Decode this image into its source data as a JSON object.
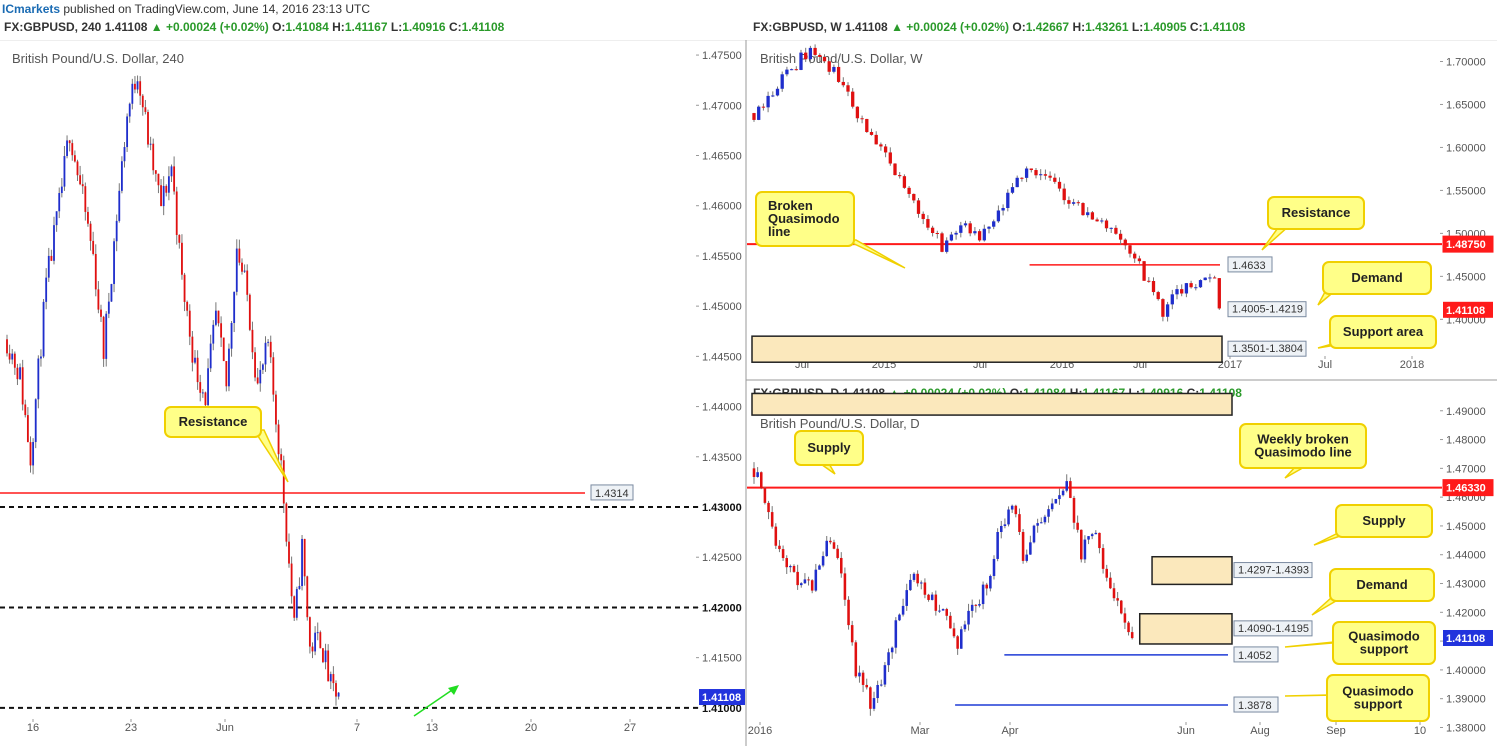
{
  "header": {
    "brand": "ICmarkets",
    "published": " published on TradingView.com, June 14, 2016 23:13 UTC"
  },
  "colors": {
    "up": "#1f2ecc",
    "down": "#e01010",
    "resistance": "#ff1a1a",
    "callout_fill": "#ffff88",
    "callout_border": "#f0d000",
    "zone_fill": "#fbe8bc",
    "blue_line": "#1f3bd6",
    "price_tag": "#2233dd"
  },
  "chart_data": [
    {
      "id": "h4",
      "type": "candlestick",
      "symbol_line": {
        "symbol": "FX:GBPUSD, 240",
        "last": "1.41108",
        "change": "+0.00024 (+0.02%)",
        "o_label": "O:",
        "o": "1.41084",
        "h_label": "H:",
        "h": "1.41167",
        "l_label": "L:",
        "l": "1.40916",
        "c_label": "C:",
        "c": "1.41108"
      },
      "title": "British Pound/U.S. Dollar, 240",
      "y_ticks": [
        "1.47500",
        "1.47000",
        "1.46500",
        "1.46000",
        "1.45500",
        "1.45000",
        "1.44500",
        "1.44000",
        "1.43500",
        "1.43000",
        "1.42500",
        "1.42000",
        "1.41500",
        "1.41000"
      ],
      "ylim": [
        1.407,
        1.4765
      ],
      "x_ticks": [
        "16",
        "23",
        "Jun",
        "7",
        "13",
        "20",
        "27"
      ],
      "x_tick_index": [
        4,
        33,
        63,
        85,
        107,
        135,
        163
      ],
      "n_bars": 180,
      "path": [
        [
          0,
          1.4467
        ],
        [
          5,
          1.443
        ],
        [
          9,
          1.435
        ],
        [
          15,
          1.452
        ],
        [
          20,
          1.46
        ],
        [
          24,
          1.4675
        ],
        [
          28,
          1.462
        ],
        [
          33,
          1.455
        ],
        [
          37,
          1.4455
        ],
        [
          42,
          1.459
        ],
        [
          46,
          1.469
        ],
        [
          50,
          1.4735
        ],
        [
          55,
          1.465
        ],
        [
          59,
          1.46
        ],
        [
          63,
          1.464
        ],
        [
          67,
          1.4525
        ],
        [
          72,
          1.444
        ],
        [
          76,
          1.441
        ],
        [
          80,
          1.449
        ],
        [
          84,
          1.442
        ],
        [
          88,
          1.456
        ],
        [
          92,
          1.451
        ],
        [
          96,
          1.442
        ],
        [
          100,
          1.446
        ],
        [
          105,
          1.434
        ],
        [
          110,
          1.418
        ],
        [
          113,
          1.426
        ],
        [
          116,
          1.416
        ],
        [
          120,
          1.417
        ],
        [
          124,
          1.412
        ],
        [
          127,
          1.41108
        ]
      ],
      "h_lines": [
        {
          "kind": "resistance",
          "value": 1.4314,
          "label": "1.4314"
        },
        {
          "kind": "dashed",
          "value": 1.43,
          "label": "1.43000"
        },
        {
          "kind": "dashed",
          "value": 1.42,
          "label": "1.42000"
        },
        {
          "kind": "dashed",
          "value": 1.41,
          "label": "1.41000"
        }
      ],
      "last_tag": "1.41108",
      "annotations": [
        {
          "text": "Resistance"
        }
      ]
    },
    {
      "id": "w",
      "type": "candlestick",
      "symbol_line": {
        "symbol": "FX:GBPUSD, W",
        "last": "1.41108",
        "change": "+0.00024 (+0.02%)",
        "o_label": "O:",
        "o": "1.42667",
        "h_label": "H:",
        "h": "1.43261",
        "l_label": "L:",
        "l": "1.40905",
        "c_label": "C:",
        "c": "1.41108"
      },
      "title": "British Pound/U.S. Dollar, W",
      "y_ticks": [
        "1.70000",
        "1.65000",
        "1.60000",
        "1.55000",
        "1.50000",
        "1.45000",
        "1.40000"
      ],
      "ylim": [
        1.355,
        1.725
      ],
      "x_ticks": [
        "Jul",
        "2015",
        "Jul",
        "2016",
        "Jul",
        "2017",
        "Jul",
        "2018"
      ],
      "x_tick_index": [
        10,
        36,
        62,
        88,
        114,
        140,
        166,
        192
      ],
      "n_bars": 100,
      "path": [
        [
          0,
          1.64
        ],
        [
          6,
          1.68
        ],
        [
          12,
          1.715
        ],
        [
          18,
          1.68
        ],
        [
          24,
          1.62
        ],
        [
          30,
          1.57
        ],
        [
          36,
          1.52
        ],
        [
          40,
          1.485
        ],
        [
          44,
          1.51
        ],
        [
          48,
          1.49
        ],
        [
          52,
          1.52
        ],
        [
          56,
          1.56
        ],
        [
          59,
          1.58
        ],
        [
          63,
          1.56
        ],
        [
          67,
          1.54
        ],
        [
          71,
          1.52
        ],
        [
          75,
          1.51
        ],
        [
          79,
          1.49
        ],
        [
          83,
          1.45
        ],
        [
          87,
          1.41
        ],
        [
          91,
          1.435
        ],
        [
          95,
          1.44
        ],
        [
          98,
          1.45
        ],
        [
          99,
          1.41108
        ]
      ],
      "zones": [
        {
          "label": "1.4005-1.4219",
          "low": 1.4005,
          "high": 1.4219,
          "from": 89
        },
        {
          "label": "1.3501-1.3804",
          "low": 1.3501,
          "high": 1.3804,
          "from": 0
        }
      ],
      "h_lines": [
        {
          "kind": "resistance",
          "value": 1.4875,
          "label": "1.48750"
        },
        {
          "kind": "resistance_thin",
          "value": 1.4633,
          "label": "1.4633",
          "from": 41
        }
      ],
      "last_tag": "1.41108",
      "annotations": [
        {
          "text": "Broken Quasimodo line"
        },
        {
          "text": "Resistance"
        },
        {
          "text": "Demand"
        },
        {
          "text": "Support area"
        }
      ]
    },
    {
      "id": "d",
      "type": "candlestick",
      "symbol_line": {
        "symbol": "FX:GBPUSD, D",
        "last": "1.41108",
        "change": "+0.00024 (+0.02%)",
        "o_label": "O:",
        "o": "1.41084",
        "h_label": "H:",
        "h": "1.41167",
        "l_label": "L:",
        "l": "1.40916",
        "c_label": "C:",
        "c": "1.41108"
      },
      "title": "British Pound/U.S. Dollar, D",
      "y_ticks": [
        "1.49000",
        "1.48000",
        "1.47000",
        "1.46000",
        "1.45000",
        "1.44000",
        "1.43000",
        "1.42000",
        "1.41000",
        "1.40000",
        "1.39000",
        "1.38000"
      ],
      "ylim": [
        1.376,
        1.492
      ],
      "x_ticks": [
        "2016",
        "Mar",
        "Apr",
        "Jun",
        "Aug",
        "Sep",
        "10"
      ],
      "x_tick_index": [
        0,
        42,
        64,
        106,
        150,
        172,
        194
      ],
      "n_bars": 110,
      "path": [
        [
          0,
          1.47
        ],
        [
          6,
          1.445
        ],
        [
          12,
          1.43
        ],
        [
          16,
          1.43
        ],
        [
          20,
          1.445
        ],
        [
          24,
          1.435
        ],
        [
          28,
          1.4
        ],
        [
          32,
          1.388
        ],
        [
          36,
          1.4
        ],
        [
          40,
          1.42
        ],
        [
          44,
          1.433
        ],
        [
          48,
          1.425
        ],
        [
          52,
          1.42
        ],
        [
          56,
          1.41
        ],
        [
          60,
          1.42
        ],
        [
          64,
          1.43
        ],
        [
          68,
          1.45
        ],
        [
          71,
          1.46
        ],
        [
          74,
          1.44
        ],
        [
          78,
          1.45
        ],
        [
          82,
          1.455
        ],
        [
          86,
          1.465
        ],
        [
          90,
          1.44
        ],
        [
          94,
          1.45
        ],
        [
          97,
          1.43
        ],
        [
          101,
          1.42
        ],
        [
          104,
          1.41108
        ]
      ],
      "zones": [
        {
          "label": "",
          "low": 1.4885,
          "high": 1.496,
          "from": 0
        },
        {
          "label": "1.4297-1.4393",
          "low": 1.4297,
          "high": 1.4393,
          "from": 65
        },
        {
          "label": "1.4090-1.4195",
          "low": 1.409,
          "high": 1.4195,
          "from": 63
        }
      ],
      "h_lines": [
        {
          "kind": "resistance",
          "value": 1.4633,
          "label": "1.46330"
        },
        {
          "kind": "support",
          "value": 1.4052,
          "label": "1.4052",
          "from": 41
        },
        {
          "kind": "support",
          "value": 1.3878,
          "label": "1.3878",
          "from": 33
        }
      ],
      "last_tag": "1.41108",
      "annotations": [
        {
          "text": "Supply"
        },
        {
          "text": "Weekly broken Quasimodo line"
        },
        {
          "text": "Supply"
        },
        {
          "text": "Demand"
        },
        {
          "text": "Quasimodo support"
        },
        {
          "text": "Quasimodo support"
        }
      ]
    }
  ]
}
